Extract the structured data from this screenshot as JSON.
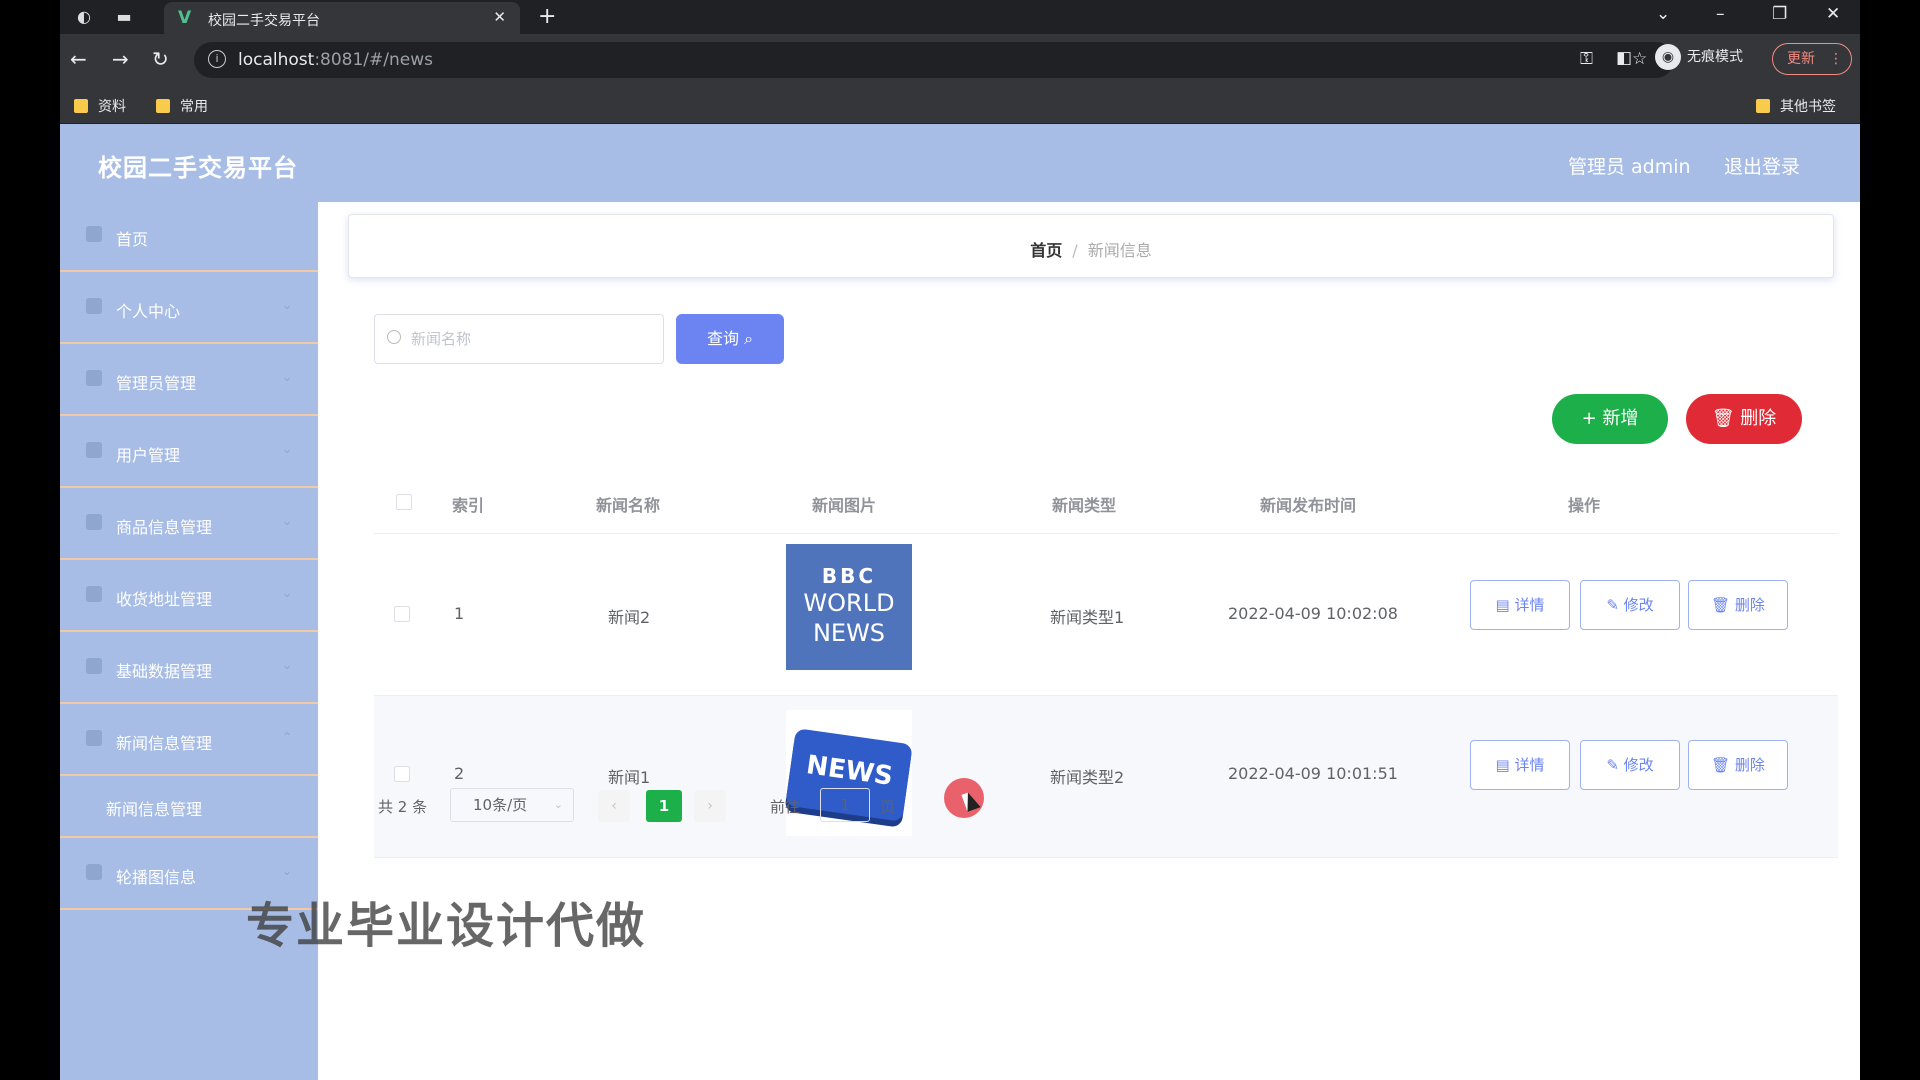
{
  "browser": {
    "tab_title": "校园二手交易平台",
    "tab_close": "✕",
    "new_tab": "+",
    "url_host": "localhost",
    "url_rest": ":8081/#/news",
    "incognito_label": "无痕模式",
    "update_label": "更新",
    "bookmarks": [
      "资料",
      "常用"
    ],
    "other_bookmarks": "其他书签"
  },
  "header": {
    "brand": "校园二手交易平台",
    "admin_label": "管理员 admin",
    "logout_label": "退出登录"
  },
  "sidebar": {
    "items": [
      {
        "label": "首页",
        "icon": "home-icon"
      },
      {
        "label": "个人中心",
        "icon": "user-icon"
      },
      {
        "label": "管理员管理",
        "icon": "admin-icon"
      },
      {
        "label": "用户管理",
        "icon": "users-icon"
      },
      {
        "label": "商品信息管理",
        "icon": "goods-icon"
      },
      {
        "label": "收货地址管理",
        "icon": "address-icon"
      },
      {
        "label": "基础数据管理",
        "icon": "data-icon"
      },
      {
        "label": "新闻信息管理",
        "icon": "news-icon"
      },
      {
        "label": "轮播图信息",
        "icon": "carousel-icon"
      }
    ],
    "submenu": {
      "label": "新闻信息管理"
    }
  },
  "breadcrumb": {
    "home": "首页",
    "separator": "/",
    "current": "新闻信息"
  },
  "search": {
    "placeholder": "新闻名称",
    "value": "",
    "query_button": "查询"
  },
  "actions": {
    "add_label": "新增",
    "delete_label": "删除"
  },
  "table": {
    "headers": [
      "索引",
      "新闻名称",
      "新闻图片",
      "新闻类型",
      "新闻发布时间",
      "操作"
    ],
    "rows": [
      {
        "index": "1",
        "name": "新闻2",
        "image": "BBC WORLD NEWS",
        "type": "新闻类型1",
        "time": "2022-04-09 10:02:08"
      },
      {
        "index": "2",
        "name": "新闻1",
        "image": "NEWS",
        "type": "新闻类型2",
        "time": "2022-04-09 10:01:51"
      }
    ],
    "row_buttons": {
      "detail": "详情",
      "edit": "修改",
      "delete": "删除"
    }
  },
  "pagination": {
    "total": "共 2 条",
    "page_size": "10条/页",
    "current_page": "1",
    "goto_label": "前往",
    "goto_value": "1",
    "page_suffix": "页"
  },
  "image_text": {
    "bbc": "BBC",
    "world": "WORLD",
    "news": "NEWS",
    "key": "NEWS"
  },
  "watermark": "专业毕业设计代做",
  "colors": {
    "primary": "#6b84f2",
    "success": "#1db04a",
    "danger": "#e02a35",
    "sidebar": "#a7bde5"
  }
}
